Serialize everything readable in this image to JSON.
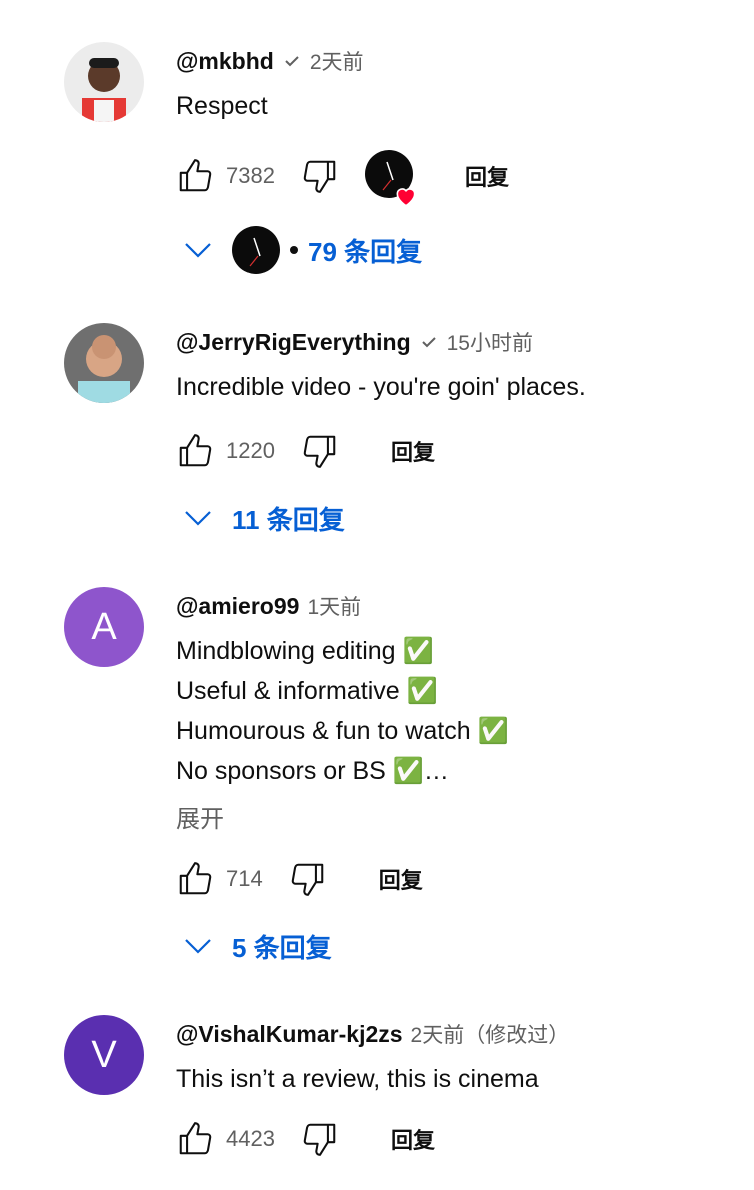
{
  "comments": [
    {
      "author": "@mkbhd",
      "verified": true,
      "time": "2天前",
      "text": "Respect",
      "likes": "7382",
      "reply_label": "回复",
      "creator_heart": true,
      "replies_label": "79 条回复",
      "avatar_type": "photo"
    },
    {
      "author": "@JerryRigEverything",
      "verified": true,
      "time": "15小时前",
      "text": "Incredible video - you're goin' places.",
      "likes": "1220",
      "reply_label": "回复",
      "replies_label": "11 条回复",
      "avatar_type": "photo"
    },
    {
      "author": "@amiero99",
      "time": "1天前",
      "text": "Mindblowing editing ✅\nUseful & informative ✅\nHumourous & fun to watch ✅\nNo sponsors or BS ✅…",
      "more_label": "展开",
      "likes": "714",
      "reply_label": "回复",
      "replies_label": "5 条回复",
      "avatar_letter": "A",
      "avatar_color": "#8e55cc"
    },
    {
      "author": "@VishalKumar-kj2zs",
      "time": "2天前（修改过）",
      "text": "This isn’t a review, this is cinema",
      "likes": "4423",
      "reply_label": "回复",
      "avatar_letter": "V",
      "avatar_color": "#5a2fb0"
    }
  ],
  "colors": {
    "link": "#065fd4",
    "muted": "#606060",
    "heart": "#ff0033"
  },
  "icons": [
    "thumb-up-icon",
    "thumb-down-icon",
    "chevron-down-icon",
    "verified-check-icon",
    "heart-icon"
  ]
}
